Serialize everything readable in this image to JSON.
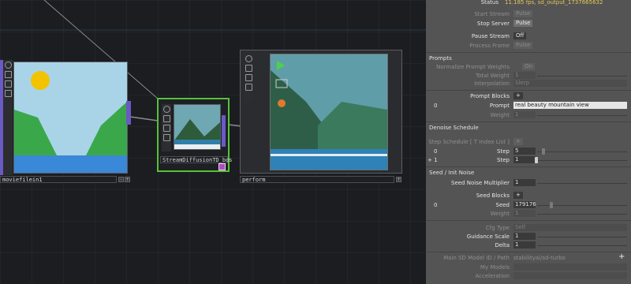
{
  "nodes": {
    "moviefilein": {
      "label": "moviefilein1"
    },
    "streamdiffusion": {
      "label": "StreamDiffusionTD_bos"
    },
    "perform": {
      "label": "perform"
    }
  },
  "panel": {
    "status": {
      "label": "Status",
      "value": "11.185 fps, sd_output_1737665632"
    },
    "start_stream": {
      "label": "Start Stream",
      "button": "Pulse"
    },
    "stop_server": {
      "label": "Stop Server",
      "button": "Pulse"
    },
    "pause_stream": {
      "label": "Pause Stream",
      "button": "Off"
    },
    "process_frame": {
      "label": "Process Frame",
      "button": "Pulse"
    },
    "sections": {
      "prompts": "Prompts",
      "denoise": "Denoise Schedule",
      "seed_noise": "Seed / Init Noise"
    },
    "normalize_prompt_weights": {
      "label": "Normalize Prompt Weights",
      "value": "On"
    },
    "total_weight": {
      "label": "Total Weight",
      "value": "1"
    },
    "interpolation": {
      "label": "Interpolation",
      "value": "Slerp"
    },
    "prompt_blocks": {
      "label": "Prompt Blocks",
      "add": "+"
    },
    "prompt_block_index": "0",
    "prompt": {
      "label": "Prompt",
      "value": "real beauty mountain view"
    },
    "prompt_weight": {
      "label": "Weight",
      "value": "1"
    },
    "step_schedule": {
      "label": "Step Schedule [ T Index List ]",
      "value": "+"
    },
    "step_index_0": "0",
    "step_index_1": "+ 1",
    "step1": {
      "label": "Step",
      "value": "5"
    },
    "step2": {
      "label": "Step",
      "value": "1"
    },
    "seed_noise_multiplier": {
      "label": "Seed Noise Multiplier",
      "value": "1"
    },
    "seed_blocks": {
      "label": "Seed Blocks",
      "add": "+"
    },
    "seed_block_index": "0",
    "seed": {
      "label": "Seed",
      "value": "179176"
    },
    "seed_weight": {
      "label": "Weight",
      "value": "1"
    },
    "cfg_type": {
      "label": "Cfg Type",
      "value": "Self"
    },
    "guidance_scale": {
      "label": "Guidance Scale",
      "value": "1"
    },
    "delta": {
      "label": "Delta",
      "value": "1"
    },
    "model_id": {
      "label": "Main SD Model ID / Path",
      "value": "stabilityai/sd-turbo"
    },
    "my_models": {
      "label": "My Models",
      "value": ""
    },
    "acceleration": {
      "label": "Acceleration",
      "value": ""
    },
    "add_param": "+"
  }
}
